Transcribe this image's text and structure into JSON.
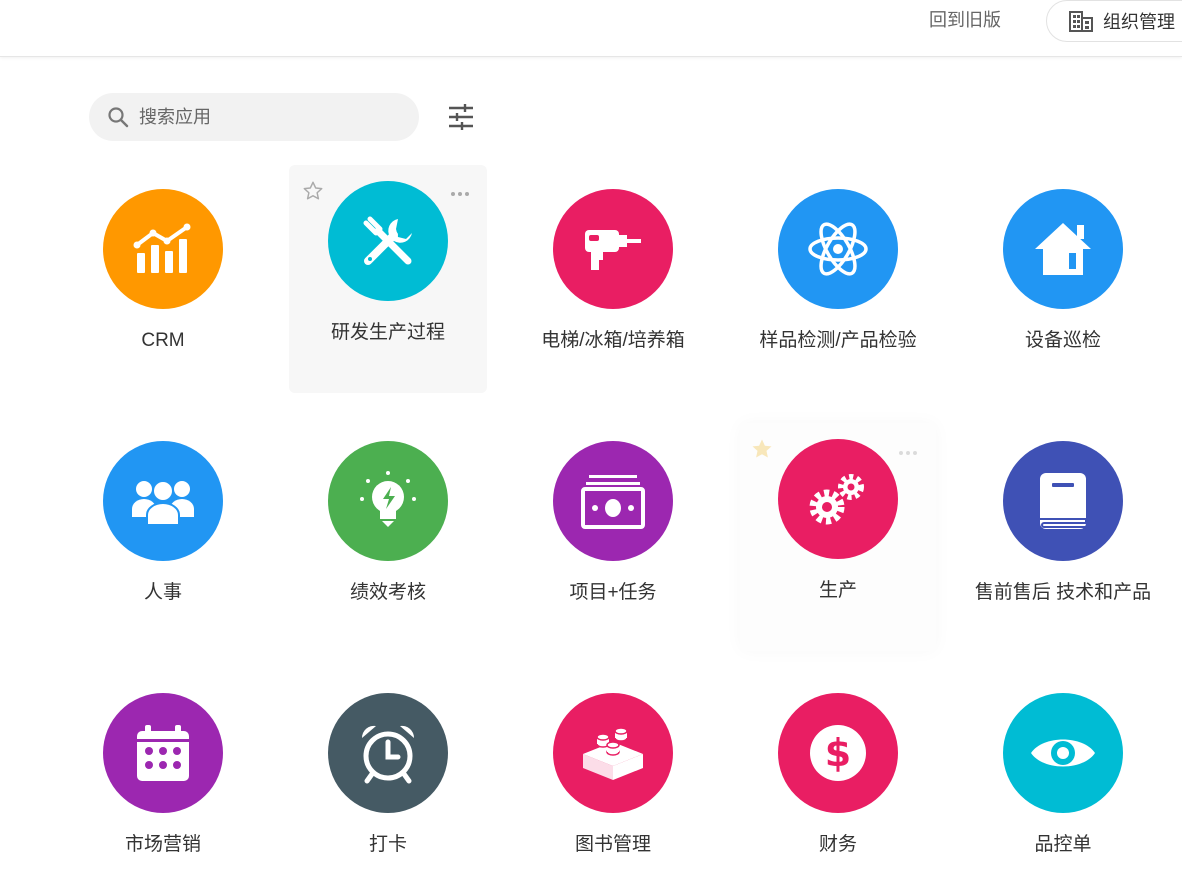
{
  "header": {
    "back_label": "回到旧版",
    "org_label": "组织管理"
  },
  "search": {
    "placeholder": "搜索应用"
  },
  "apps": [
    {
      "name": "CRM",
      "color": "#ff9800",
      "icon": "chart-icon"
    },
    {
      "name": "研发生产过程",
      "color": "#00bcd4",
      "icon": "tools-icon"
    },
    {
      "name": "电梯/冰箱/培养箱",
      "color": "#e91e63",
      "icon": "drill-icon"
    },
    {
      "name": "样品检测/产品检验",
      "color": "#2196f3",
      "icon": "atom-icon"
    },
    {
      "name": "设备巡检",
      "color": "#2196f3",
      "icon": "home-icon"
    },
    {
      "name": "人事",
      "color": "#2196f3",
      "icon": "people-icon"
    },
    {
      "name": "绩效考核",
      "color": "#4caf50",
      "icon": "lightbulb-icon"
    },
    {
      "name": "项目+任务",
      "color": "#9c27b0",
      "icon": "money-icon"
    },
    {
      "name": "生产",
      "color": "#e91e63",
      "icon": "gears-icon"
    },
    {
      "name": "售前售后 技术和产品",
      "color": "#3f51b5",
      "icon": "book-icon"
    },
    {
      "name": "市场营销",
      "color": "#9c27b0",
      "icon": "calendar-icon"
    },
    {
      "name": "打卡",
      "color": "#455a64",
      "icon": "alarm-clock-icon"
    },
    {
      "name": "图书管理",
      "color": "#e91e63",
      "icon": "blocks-icon"
    },
    {
      "name": "财务",
      "color": "#e91e63",
      "icon": "dollar-icon"
    },
    {
      "name": "品控单",
      "color": "#00bcd4",
      "icon": "eye-icon"
    }
  ]
}
